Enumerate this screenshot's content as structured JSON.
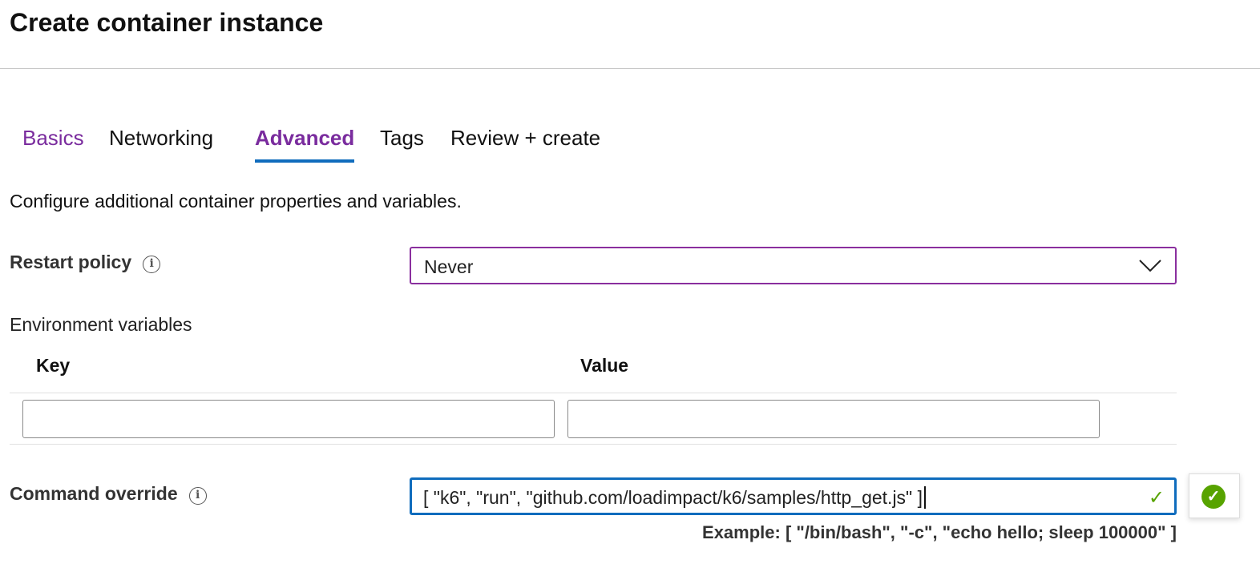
{
  "header": {
    "title": "Create container instance"
  },
  "tabs": [
    {
      "label": "Basics",
      "state": "visited"
    },
    {
      "label": "Networking",
      "state": "default"
    },
    {
      "label": "Advanced",
      "state": "active"
    },
    {
      "label": "Tags",
      "state": "default"
    },
    {
      "label": "Review + create",
      "state": "default"
    }
  ],
  "description": "Configure additional container properties and variables.",
  "restart_policy": {
    "label": "Restart policy",
    "value": "Never",
    "info_icon": "info-icon"
  },
  "env": {
    "label": "Environment variables",
    "key_header": "Key",
    "value_header": "Value",
    "rows": [
      {
        "key": "",
        "value": ""
      }
    ]
  },
  "command": {
    "label": "Command override",
    "value": "[ \"k6\", \"run\", \"github.com/loadimpact/k6/samples/http_get.js\" ]",
    "example": "Example: [ \"/bin/bash\", \"-c\", \"echo hello; sleep 100000\" ]",
    "valid": true
  },
  "colors": {
    "accent": "#0f6cbd",
    "purple": "#7a2c9e",
    "success": "#57a300"
  }
}
